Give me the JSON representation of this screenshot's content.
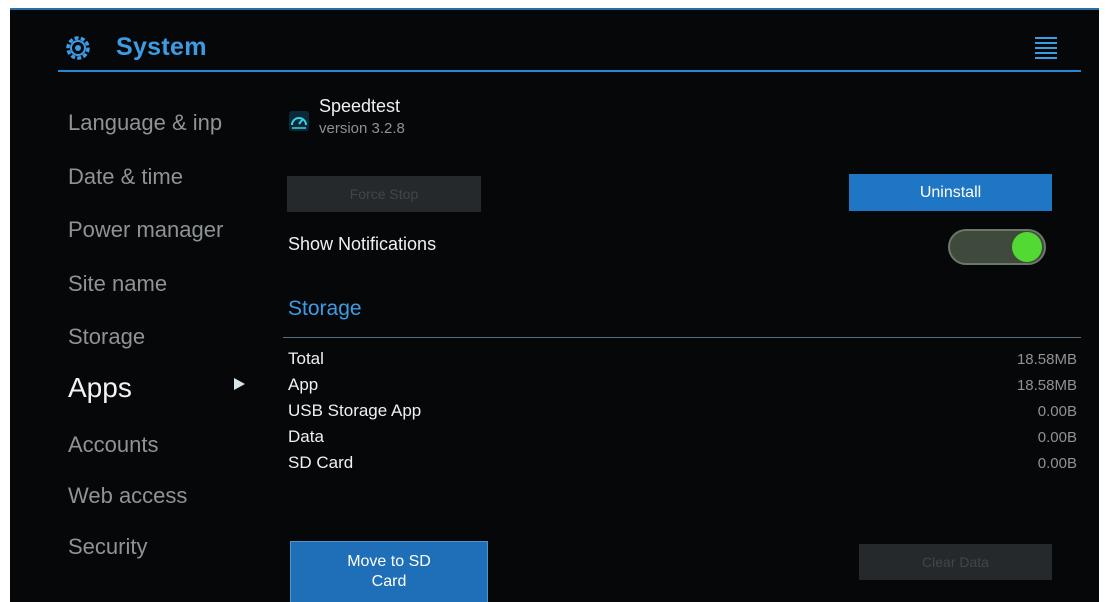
{
  "header": {
    "title": "System",
    "icon": "gear-icon",
    "menu_icon": "menu-icon"
  },
  "sidebar": {
    "items": [
      {
        "label": "Language & inp"
      },
      {
        "label": "Date & time"
      },
      {
        "label": "Power manager"
      },
      {
        "label": "Site name"
      },
      {
        "label": "Storage"
      },
      {
        "label": "Apps",
        "active": true
      },
      {
        "label": "Accounts"
      },
      {
        "label": "Web access"
      },
      {
        "label": "Security"
      }
    ]
  },
  "app": {
    "name": "Speedtest",
    "version": "version 3.2.8",
    "icon": "speedometer-icon"
  },
  "buttons": {
    "force_stop": "Force Stop",
    "uninstall": "Uninstall",
    "move_sd": "Move to SD Card",
    "clear_cache": "Clear Data"
  },
  "notifications": {
    "label": "Show Notifications",
    "enabled": true
  },
  "storage": {
    "title": "Storage",
    "rows": [
      {
        "label": "Total",
        "value": "18.58MB"
      },
      {
        "label": "App",
        "value": "18.58MB"
      },
      {
        "label": "USB Storage App",
        "value": "0.00B"
      },
      {
        "label": "Data",
        "value": "0.00B"
      },
      {
        "label": "SD Card",
        "value": "0.00B"
      }
    ]
  },
  "colors": {
    "accent": "#3d9ce6",
    "button": "#1f76c4",
    "toggle_on": "#53d934",
    "background": "#050708"
  }
}
